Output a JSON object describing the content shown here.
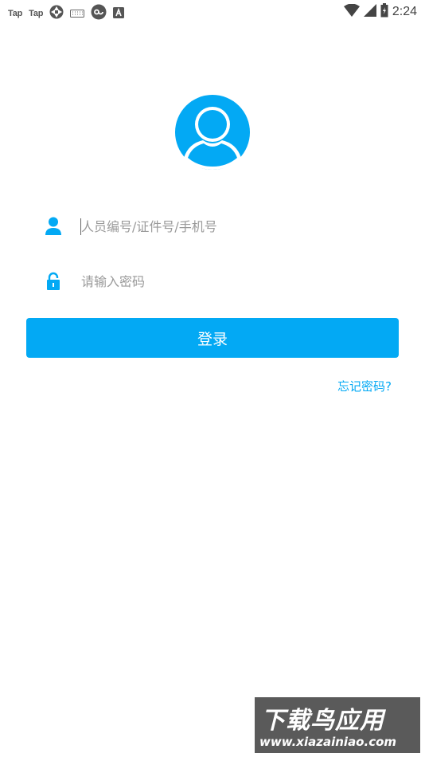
{
  "status_bar": {
    "left_labels": [
      "Tap",
      "Tap"
    ],
    "icons": [
      "aperture-icon",
      "keyboard-icon",
      "cloud-sync-icon",
      "a-badge-icon"
    ],
    "right_icons": [
      "wifi-icon",
      "cellular-signal-icon",
      "battery-icon"
    ],
    "time": "2:24"
  },
  "colors": {
    "accent": "#03a9f4",
    "placeholder": "#9a9a9a"
  },
  "login_form": {
    "username": {
      "icon": "user-icon",
      "placeholder": "人员编号/证件号/手机号",
      "value": ""
    },
    "password": {
      "icon": "lock-icon",
      "placeholder": "请输入密码",
      "value": ""
    },
    "login_label": "登录",
    "forgot_label": "忘记密码?"
  },
  "watermark": {
    "title": "下载鸟应用",
    "url": "www.xiazainiao.com"
  }
}
